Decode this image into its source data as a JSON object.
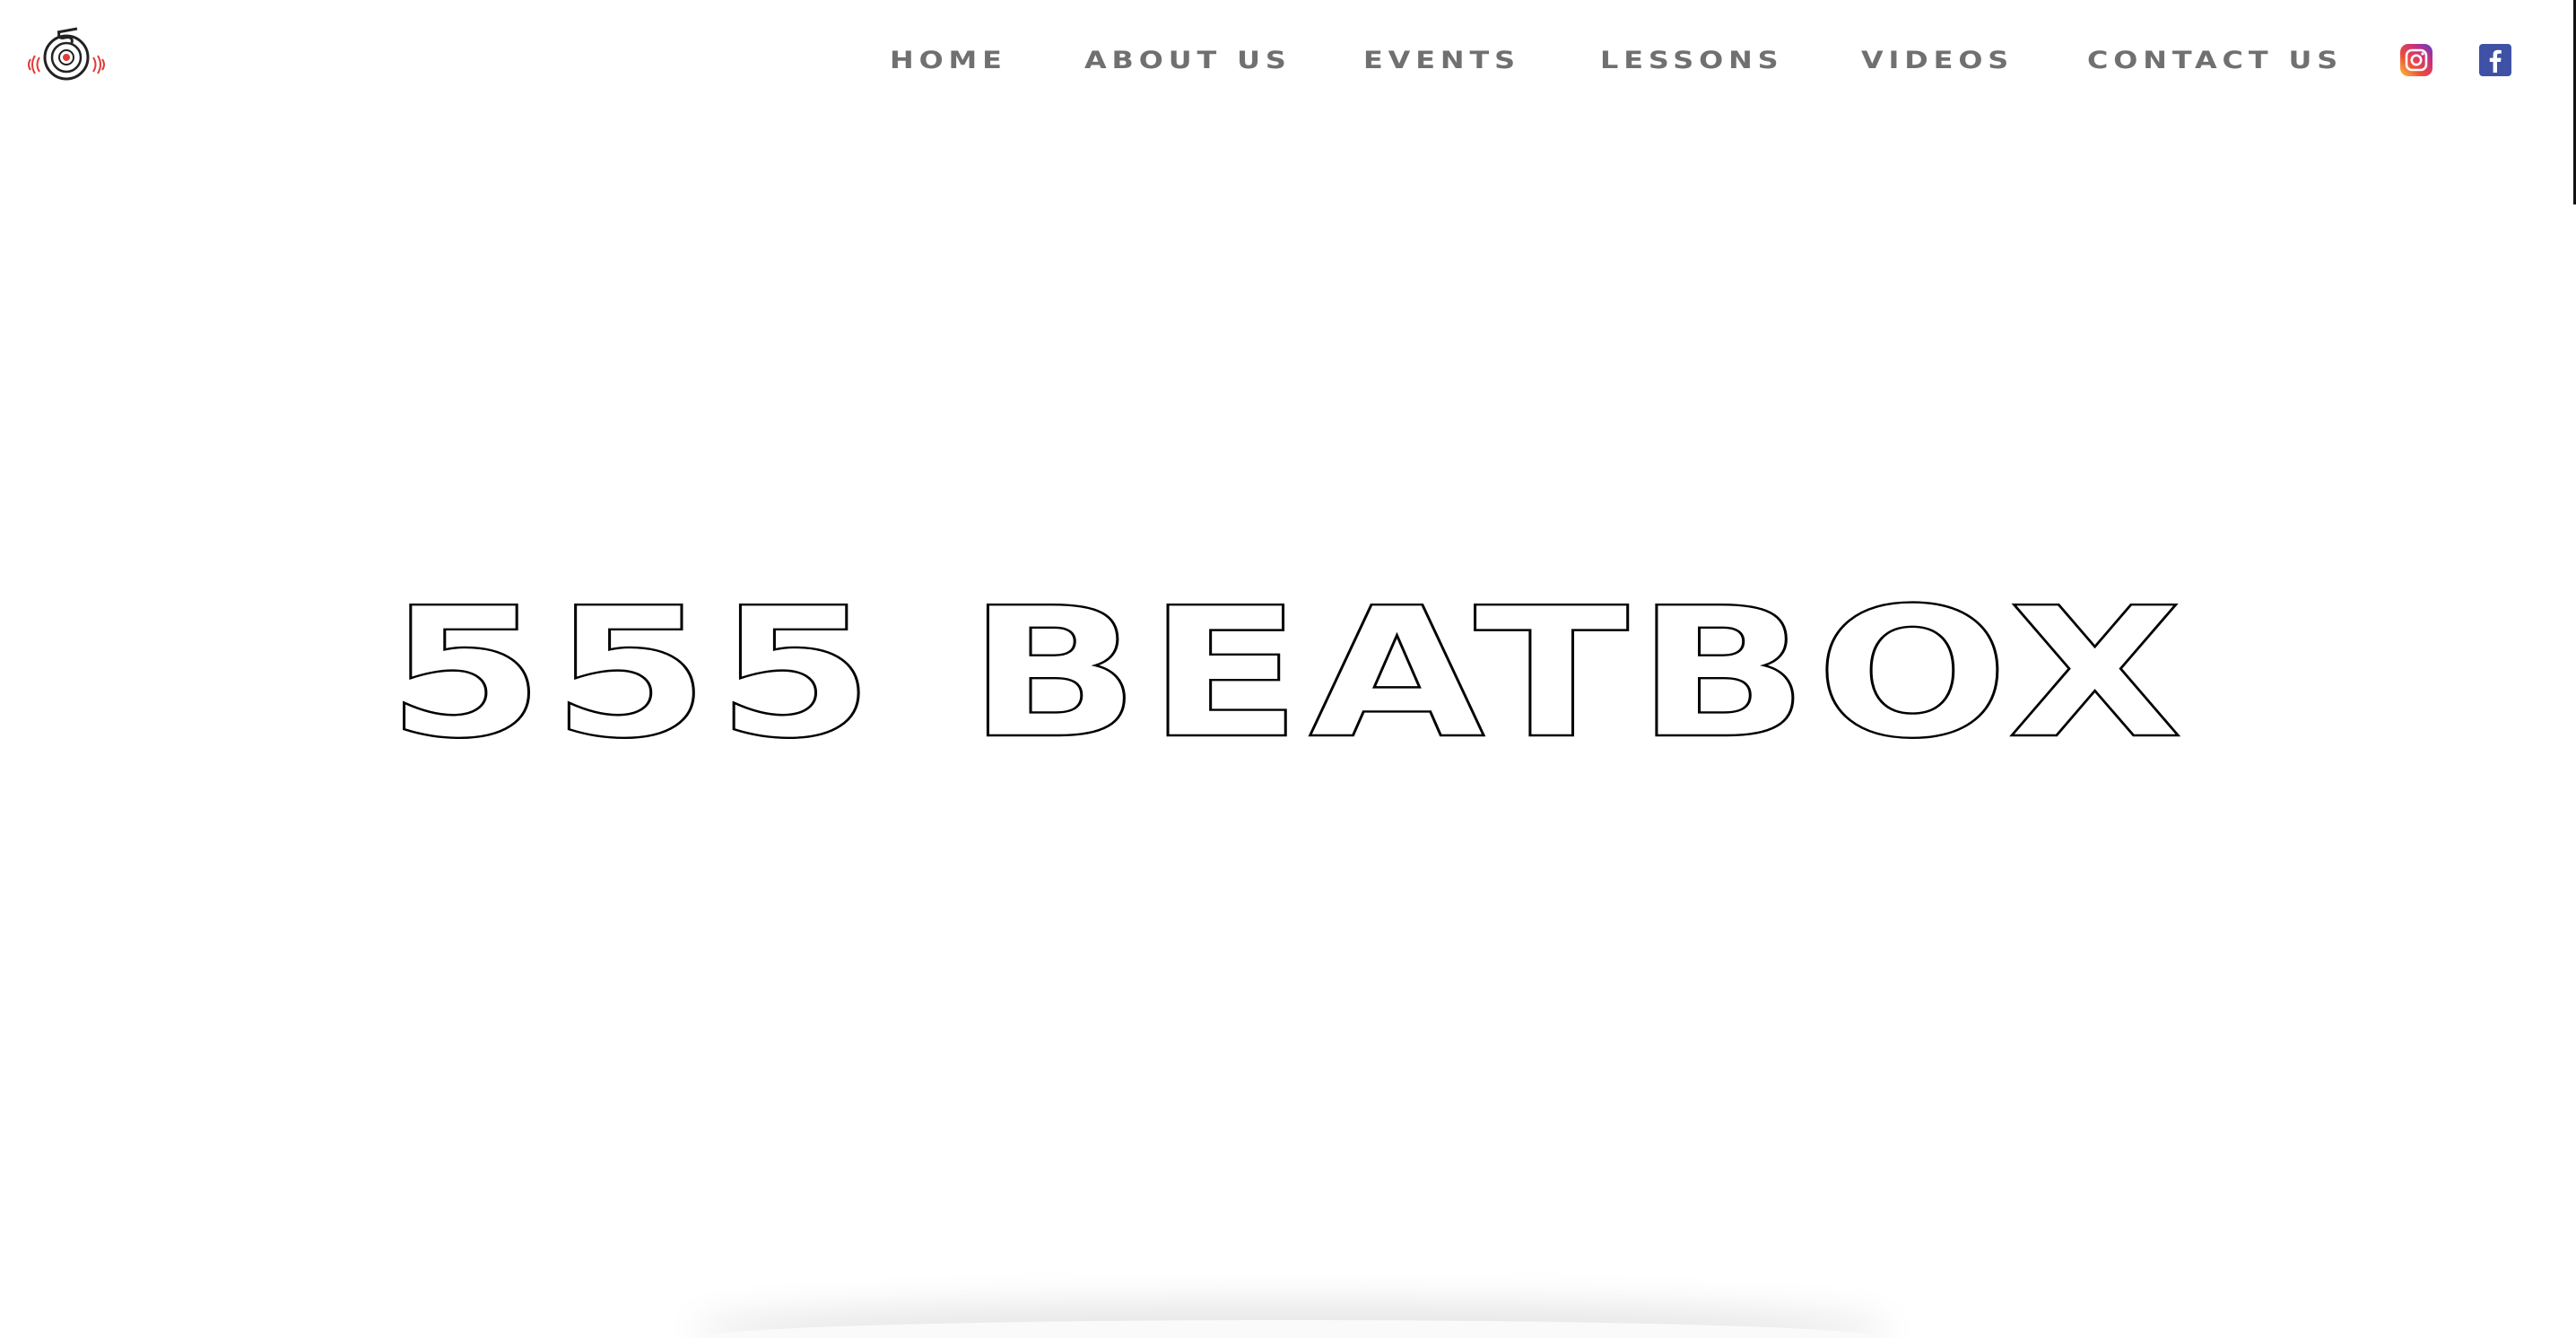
{
  "nav": {
    "items": [
      {
        "label": "HOME"
      },
      {
        "label": "ABOUT US"
      },
      {
        "label": "EVENTS"
      },
      {
        "label": "LESSONS"
      },
      {
        "label": "VIDEOS"
      },
      {
        "label": "CONTACT US"
      }
    ]
  },
  "social": {
    "instagram_icon": "instagram-icon",
    "facebook_icon": "facebook-icon",
    "facebook_color": "#3b5998"
  },
  "hero": {
    "title": "555 BEATBOX"
  },
  "colors": {
    "nav_text": "#707070",
    "background": "#ffffff",
    "logo_accent": "#e23a3a"
  }
}
